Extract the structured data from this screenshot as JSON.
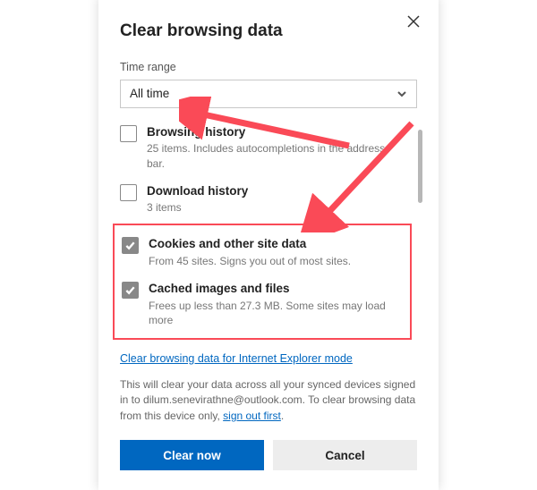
{
  "title": "Clear browsing data",
  "timeRange": {
    "label": "Time range",
    "value": "All time"
  },
  "items": [
    {
      "key": "browsing",
      "checked": false,
      "label": "Browsing history",
      "sub": "25 items. Includes autocompletions in the address bar."
    },
    {
      "key": "download",
      "checked": false,
      "label": "Download history",
      "sub": "3 items"
    },
    {
      "key": "cookies",
      "checked": true,
      "label": "Cookies and other site data",
      "sub": "From 45 sites. Signs you out of most sites."
    },
    {
      "key": "cache",
      "checked": true,
      "label": "Cached images and files",
      "sub": "Frees up less than 27.3 MB. Some sites may load more"
    }
  ],
  "ieLink": "Clear browsing data for Internet Explorer mode",
  "footnote": {
    "pre": "This will clear your data across all your synced devices signed in to dilum.senevirathne@outlook.com. To clear browsing data from this device only, ",
    "link": "sign out first",
    "suffix": "."
  },
  "buttons": {
    "primary": "Clear now",
    "secondary": "Cancel"
  }
}
